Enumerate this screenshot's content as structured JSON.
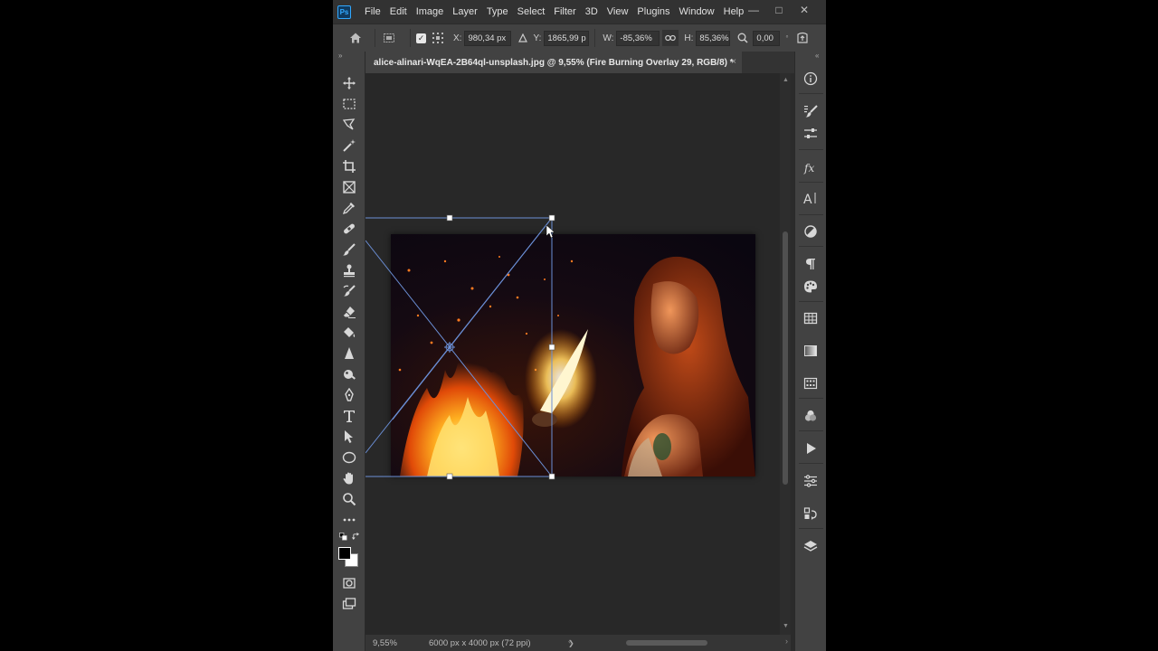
{
  "app": {
    "logo": "Ps",
    "menu": [
      "File",
      "Edit",
      "Image",
      "Layer",
      "Type",
      "Select",
      "Filter",
      "3D",
      "View",
      "Plugins",
      "Window",
      "Help"
    ],
    "window_controls": {
      "minimize": "—",
      "maximize": "□",
      "close": "✕"
    }
  },
  "options": {
    "x_label": "X:",
    "x_value": "980,34 px",
    "y_label": "Y:",
    "y_value": "1865,99 p",
    "w_label": "W:",
    "w_value": "-85,36%",
    "h_label": "H:",
    "h_value": "85,36%",
    "angle_value": "0,00"
  },
  "document": {
    "tab_title": "alice-alinari-WqEA-2B64ql-unsplash.jpg @ 9,55% (Fire Burning Overlay 29, RGB/8) *",
    "tab_close": "×"
  },
  "status": {
    "zoom": "9,55%",
    "doc_size": "6000 px x 4000 px (72 ppi)",
    "arrow": "❯"
  },
  "icons": {
    "tools": [
      "move-icon",
      "marquee-icon",
      "lasso-icon",
      "magic-wand-icon",
      "crop-icon",
      "frame-icon",
      "eyedropper-icon",
      "healing-brush-icon",
      "brush-icon",
      "clone-stamp-icon",
      "history-brush-icon",
      "eraser-icon",
      "paint-bucket-icon",
      "sharpen-icon",
      "dodge-icon",
      "pen-icon",
      "type-icon",
      "path-selection-icon",
      "ellipse-icon",
      "hand-icon",
      "zoom-icon",
      "more-tools-icon"
    ],
    "panels": [
      "info-icon",
      "brush-settings-icon",
      "adjust-icon",
      "fx-icon",
      "character-icon",
      "adjustments-icon",
      "paragraph-icon",
      "swatches-icon",
      "table-icon",
      "gradient-icon",
      "patterns-icon",
      "channels-icon",
      "actions-icon",
      "properties-icon",
      "history-icon",
      "layers-icon"
    ]
  },
  "colors": {
    "foreground": "#000000",
    "background": "#ffffff",
    "transform_line": "#6b8fd6"
  }
}
